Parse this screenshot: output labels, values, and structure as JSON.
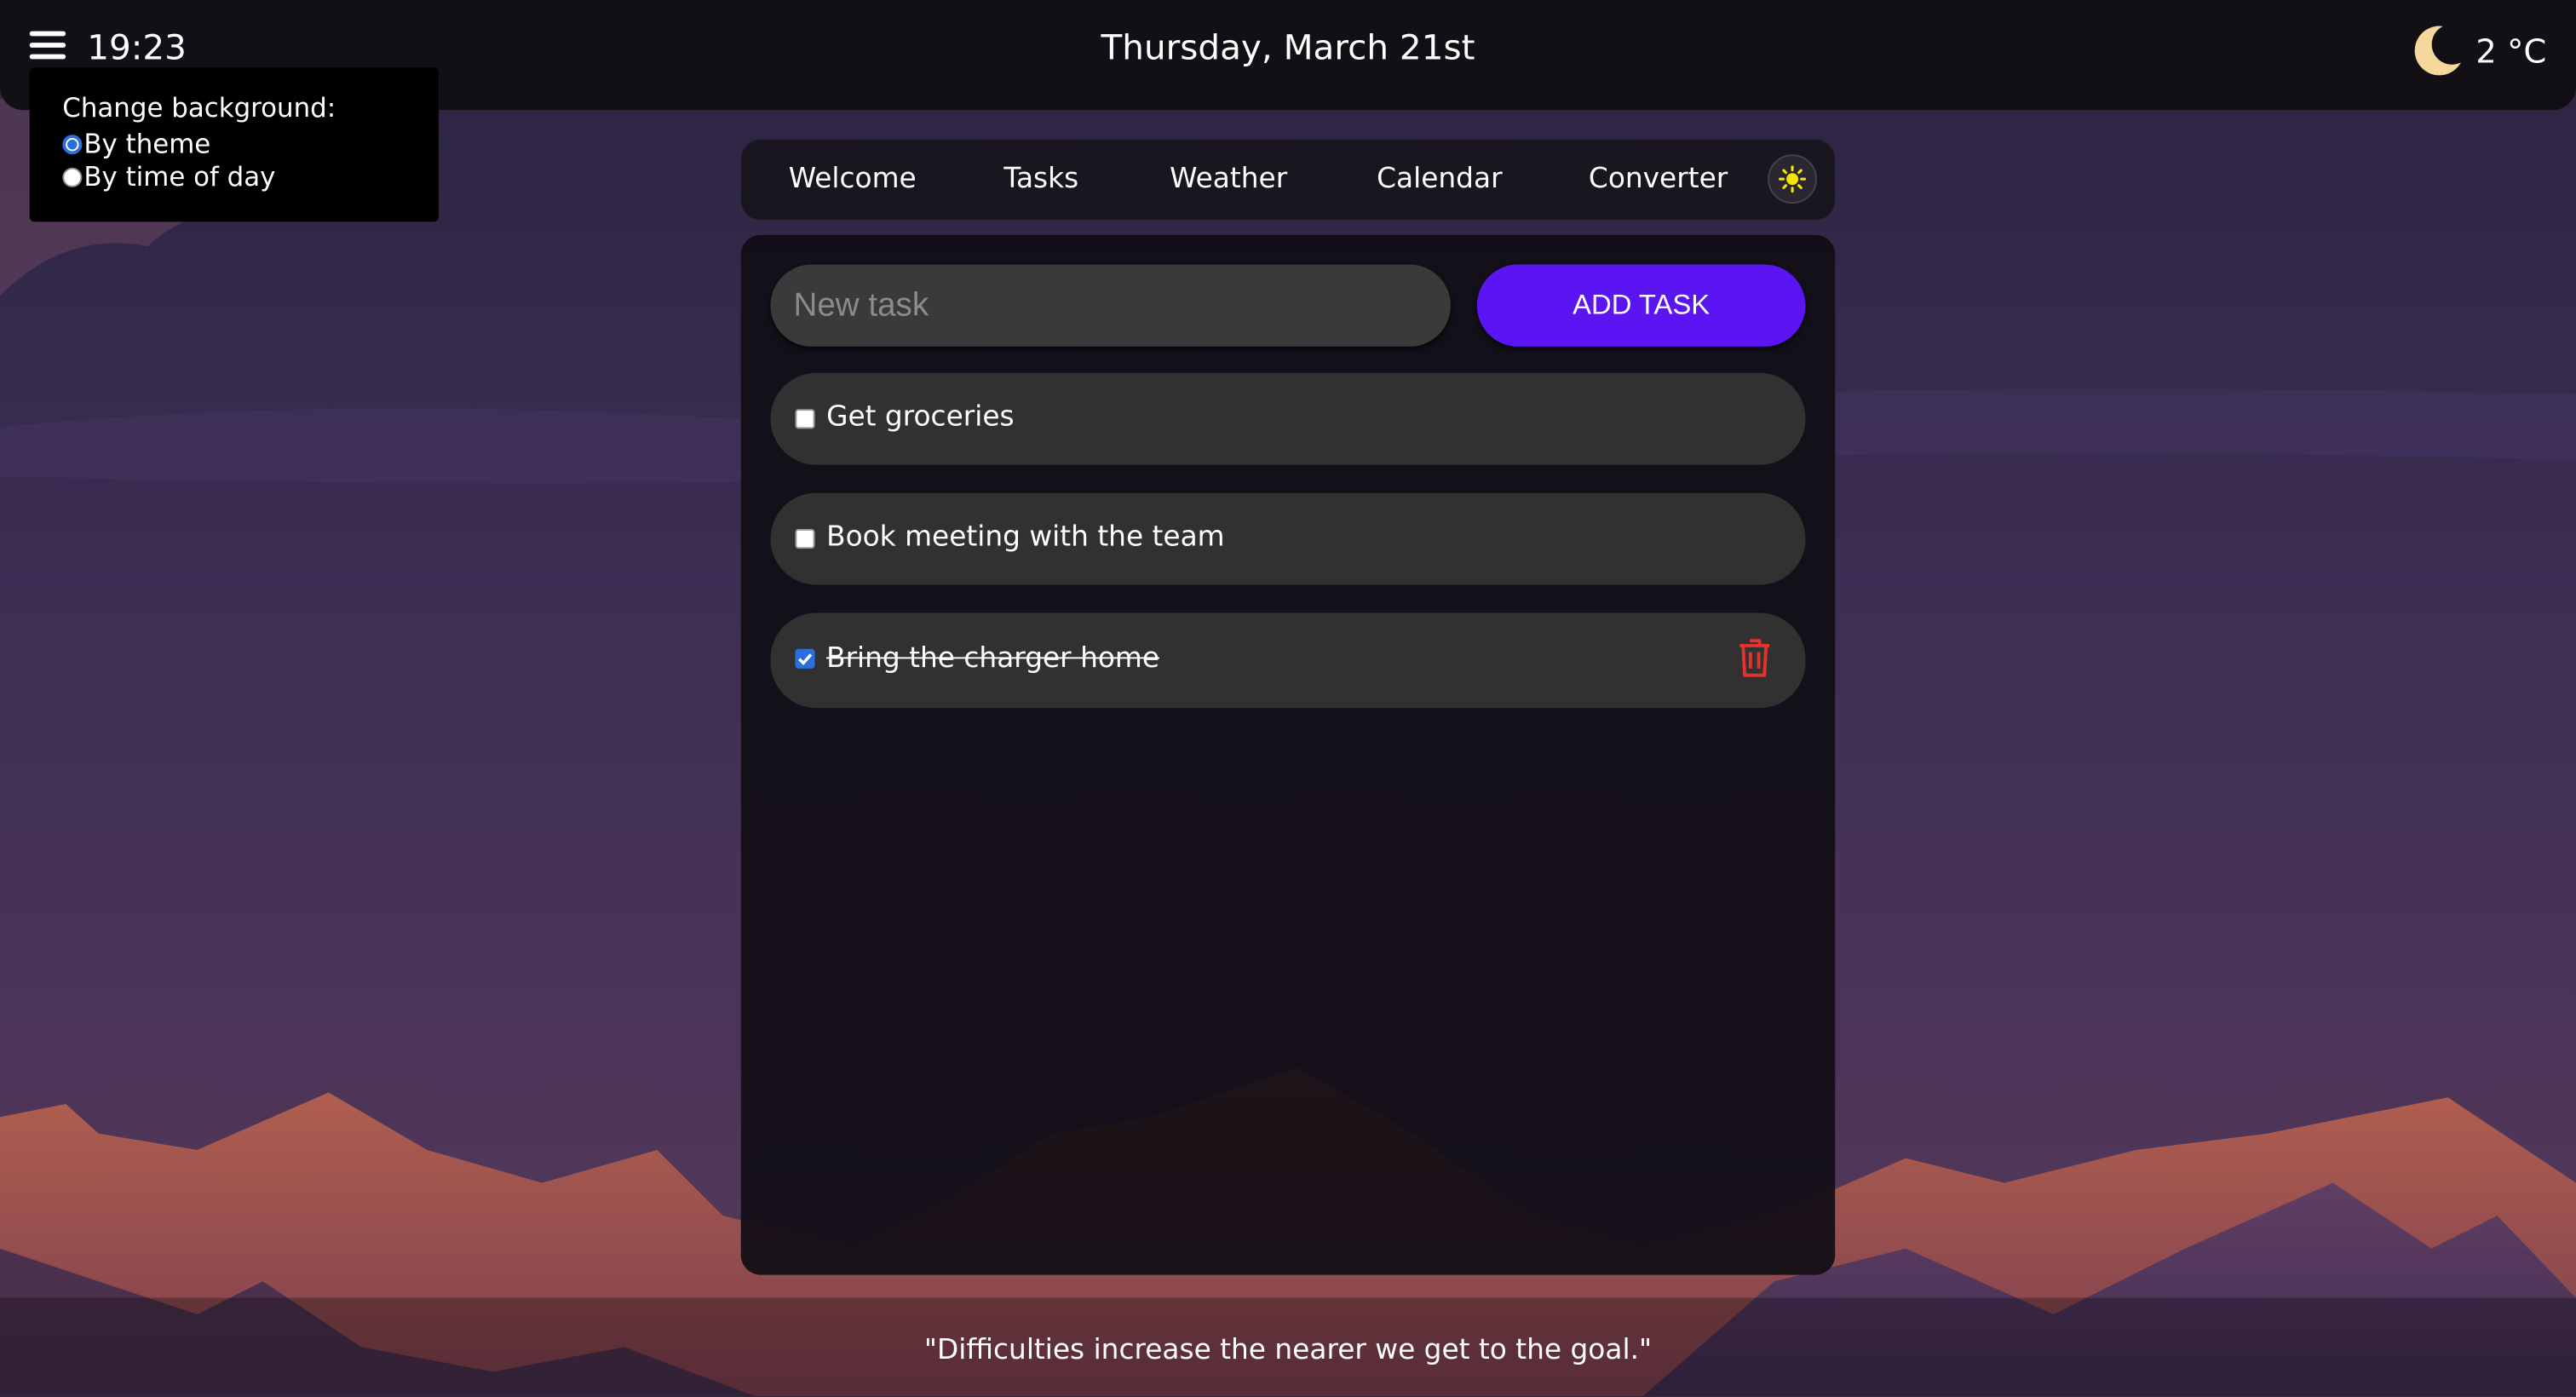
{
  "header": {
    "time": "19:23",
    "date": "Thursday, March 21st",
    "temperature": "2 °C",
    "weather_icon": "moon-icon",
    "menu_icon": "hamburger-menu-icon"
  },
  "background_menu": {
    "title": "Change background:",
    "options": [
      {
        "label": "By theme",
        "selected": true
      },
      {
        "label": "By time of day",
        "selected": false
      }
    ]
  },
  "nav": {
    "tabs": [
      "Welcome",
      "Tasks",
      "Weather",
      "Calendar",
      "Converter"
    ],
    "theme_toggle_icon": "sun-icon"
  },
  "tasks": {
    "input_placeholder": "New task",
    "input_value": "",
    "add_button_label": "ADD TASK",
    "items": [
      {
        "label": "Get groceries",
        "done": false
      },
      {
        "label": "Book meeting with the team",
        "done": false
      },
      {
        "label": "Bring the charger home",
        "done": true
      }
    ]
  },
  "quote": "\"Difficulties increase the nearer we get to the goal.\"",
  "colors": {
    "accent": "#5b14f2",
    "checkbox_checked": "#2a6fdb",
    "delete": "#e5322d",
    "moon": "#f3d79b",
    "sun": "#f5e400"
  }
}
